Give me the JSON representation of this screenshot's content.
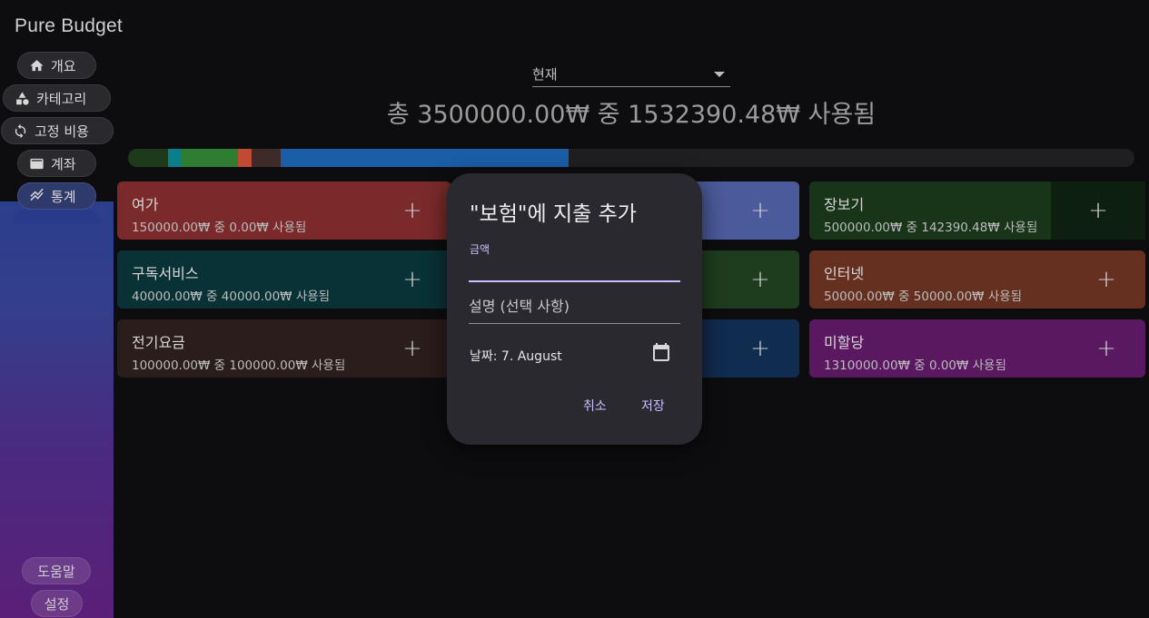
{
  "app": {
    "title": "Pure Budget"
  },
  "nav": {
    "overview": "개요",
    "categories": "카테고리",
    "fixed_costs": "고정 비용",
    "accounts": "계좌",
    "stats": "통계",
    "help": "도움말",
    "settings": "설정"
  },
  "header": {
    "period_value": "현재",
    "summary": "총 3500000.00₩ 중 1532390.48₩ 사용됨"
  },
  "budget_bar": {
    "segments": [
      {
        "color": "#1d3a1a",
        "fraction": 0.04
      },
      {
        "color": "#0a7f8a",
        "fraction": 0.012
      },
      {
        "color": "#2e7d32",
        "fraction": 0.057
      },
      {
        "color": "#c14b32",
        "fraction": 0.014
      },
      {
        "color": "#3e2b27",
        "fraction": 0.029
      },
      {
        "color": "#1a5ea8",
        "fraction": 0.286
      }
    ],
    "track_color": "#1f1f22"
  },
  "categories": [
    {
      "name": "여가",
      "sub": "150000.00₩ 중 0.00₩ 사용됨",
      "color": "#7a2a2a"
    },
    {
      "name": "",
      "sub": "",
      "color": "#4a5a9a"
    },
    {
      "name": "장보기",
      "sub": "500000.00₩ 중 142390.48₩ 사용됨",
      "color": "#18351a"
    },
    {
      "name": "구독서비스",
      "sub": "40000.00₩ 중 40000.00₩ 사용됨",
      "color": "#093236"
    },
    {
      "name": "",
      "sub": "",
      "color": "#1e3d1e"
    },
    {
      "name": "인터넷",
      "sub": "50000.00₩ 중 50000.00₩ 사용됨",
      "color": "#65301f"
    },
    {
      "name": "전기요금",
      "sub": "100000.00₩ 중 100000.00₩ 사용됨",
      "color": "#2a1d1b"
    },
    {
      "name": "",
      "sub": "",
      "color": "#102c4e"
    },
    {
      "name": "미할당",
      "sub": "1310000.00₩ 중 0.00₩ 사용됨",
      "color": "#5a1860"
    }
  ],
  "add_label": "+",
  "dialog": {
    "title": "\"보험\"에 지출 추가",
    "amount_label": "금액",
    "amount_value": "",
    "description_placeholder": "설명 (선택 사항)",
    "date_label": "날짜: 7. August",
    "cancel": "취소",
    "save": "저장"
  }
}
